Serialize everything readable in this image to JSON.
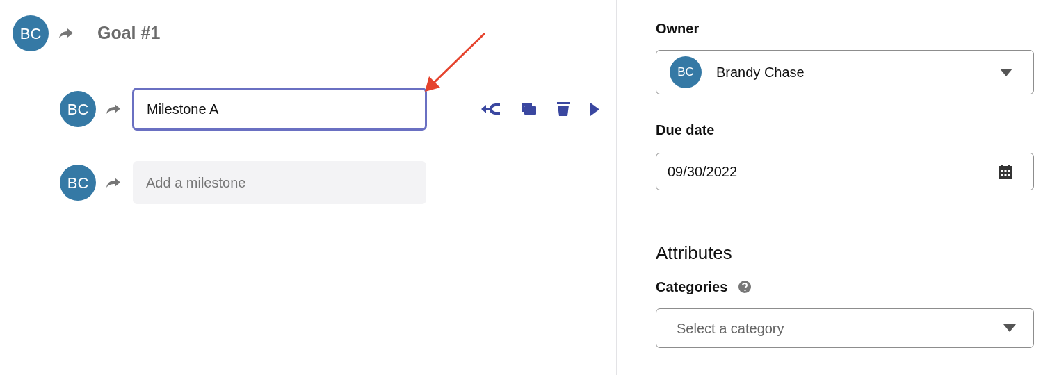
{
  "goal": {
    "avatar": "BC",
    "title": "Goal #1"
  },
  "milestones": [
    {
      "kind": "input",
      "avatar": "BC",
      "value": "Milestone A",
      "focused": true
    },
    {
      "kind": "add",
      "avatar": "BC",
      "placeholder": "Add a milestone"
    }
  ],
  "owner": {
    "label": "Owner",
    "avatar": "BC",
    "name": "Brandy Chase"
  },
  "due_date": {
    "label": "Due date",
    "value": "09/30/2022"
  },
  "attributes": {
    "heading": "Attributes",
    "categories_label": "Categories",
    "placeholder": "Select a category"
  }
}
